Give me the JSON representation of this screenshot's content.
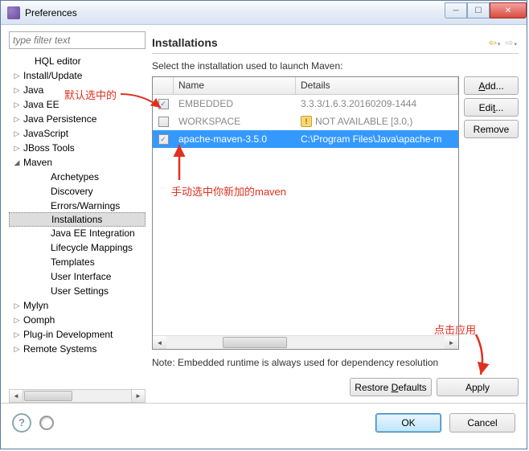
{
  "window": {
    "title": "Preferences"
  },
  "filter": {
    "placeholder": "type filter text"
  },
  "tree": [
    {
      "label": "HQL editor",
      "level": 1,
      "exp": ""
    },
    {
      "label": "Install/Update",
      "level": 0,
      "exp": "▷"
    },
    {
      "label": "Java",
      "level": 0,
      "exp": "▷"
    },
    {
      "label": "Java EE",
      "level": 0,
      "exp": "▷"
    },
    {
      "label": "Java Persistence",
      "level": 0,
      "exp": "▷"
    },
    {
      "label": "JavaScript",
      "level": 0,
      "exp": "▷"
    },
    {
      "label": "JBoss Tools",
      "level": 0,
      "exp": "▷"
    },
    {
      "label": "Maven",
      "level": 0,
      "exp": "◢"
    },
    {
      "label": "Archetypes",
      "level": 2,
      "exp": ""
    },
    {
      "label": "Discovery",
      "level": 2,
      "exp": ""
    },
    {
      "label": "Errors/Warnings",
      "level": 2,
      "exp": ""
    },
    {
      "label": "Installations",
      "level": 2,
      "exp": "",
      "selected": true
    },
    {
      "label": "Java EE Integration",
      "level": 2,
      "exp": ""
    },
    {
      "label": "Lifecycle Mappings",
      "level": 2,
      "exp": ""
    },
    {
      "label": "Templates",
      "level": 2,
      "exp": ""
    },
    {
      "label": "User Interface",
      "level": 2,
      "exp": ""
    },
    {
      "label": "User Settings",
      "level": 2,
      "exp": ""
    },
    {
      "label": "Mylyn",
      "level": 0,
      "exp": "▷"
    },
    {
      "label": "Oomph",
      "level": 0,
      "exp": "▷"
    },
    {
      "label": "Plug-in Development",
      "level": 0,
      "exp": "▷"
    },
    {
      "label": "Remote Systems",
      "level": 0,
      "exp": "▷"
    }
  ],
  "page": {
    "title": "Installations",
    "desc": "Select the installation used to launch Maven:",
    "note": "Note: Embedded runtime is always used for dependency resolution"
  },
  "table": {
    "headers": {
      "name": "Name",
      "details": "Details"
    },
    "rows": [
      {
        "checked": true,
        "name": "EMBEDDED",
        "details": "3.3.3/1.6.3.20160209-1444",
        "muted": true
      },
      {
        "checked": false,
        "name": "WORKSPACE",
        "details": "NOT AVAILABLE [3.0,)",
        "muted": true,
        "warn": true
      },
      {
        "checked": true,
        "name": "apache-maven-3.5.0",
        "details": "C:\\Program Files\\Java\\apache-m",
        "selected": true
      }
    ]
  },
  "buttons": {
    "add": "Add...",
    "edit": "Edit...",
    "remove": "Remove",
    "restore": "Restore Defaults",
    "apply": "Apply",
    "ok": "OK",
    "cancel": "Cancel"
  },
  "annotations": {
    "a1": "默认选中的",
    "a2": "手动选中你新加的maven",
    "a3": "点击应用"
  }
}
